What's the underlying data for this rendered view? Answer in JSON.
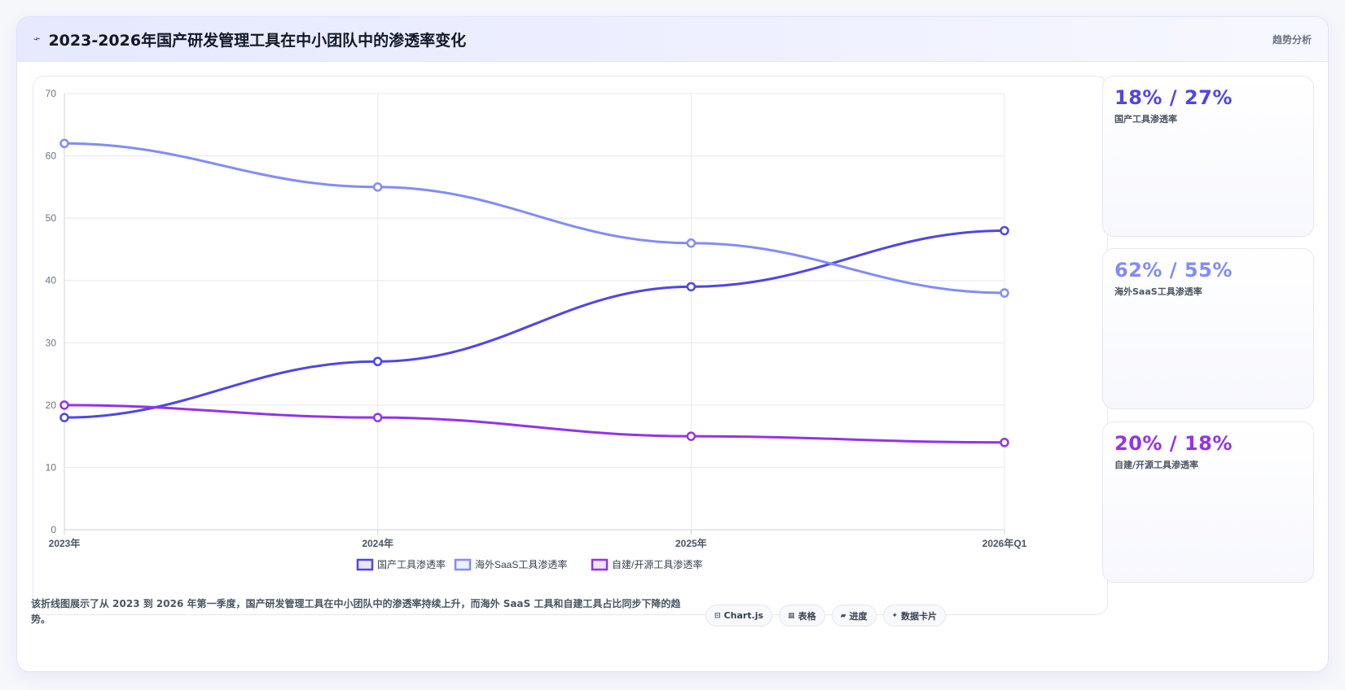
{
  "header": {
    "icon": "trend-line-icon",
    "title": "2023-2026年国产研发管理工具在中小团队中的渗透率变化",
    "right_label": "趋势分析"
  },
  "chart_data": {
    "type": "line",
    "x": [
      "2023年",
      "2024年",
      "2025年",
      "2026年Q1"
    ],
    "ylim": [
      0,
      70
    ],
    "yticks": [
      0,
      10,
      20,
      30,
      40,
      50,
      60,
      70
    ],
    "grid": true,
    "legend_position": "bottom",
    "series": [
      {
        "name": "国产工具渗透率",
        "color": "#4f46e5",
        "values": [
          18,
          27,
          39,
          48
        ]
      },
      {
        "name": "海外SaaS工具渗透率",
        "color": "#818cf8",
        "values": [
          62,
          55,
          46,
          38
        ]
      },
      {
        "name": "自建/开源工具渗透率",
        "color": "#9333ea",
        "values": [
          20,
          18,
          15,
          14
        ]
      }
    ]
  },
  "stats": [
    {
      "value": "18% / 27%",
      "label": "国产工具渗透率",
      "color": "#4f46e5"
    },
    {
      "value": "62% / 55%",
      "label": "海外SaaS工具渗透率",
      "color": "#818cf8"
    },
    {
      "value": "20% / 18%",
      "label": "自建/开源工具渗透率",
      "color": "#9333ea"
    }
  ],
  "footer": {
    "description": "该折线图展示了从 2023 到 2026 年第一季度，国产研发管理工具在中小团队中的渗透率持续上升，而海外 SaaS 工具和自建工具占比同步下降的趋势。",
    "pills": [
      {
        "icon": "chart-icon",
        "glyph": "⊟",
        "label": "Chart.js"
      },
      {
        "icon": "table-icon",
        "glyph": "▦",
        "label": "表格"
      },
      {
        "icon": "progress-icon",
        "glyph": "▰",
        "label": "进度"
      },
      {
        "icon": "sparkle-icon",
        "glyph": "✦",
        "label": "数据卡片"
      }
    ]
  }
}
